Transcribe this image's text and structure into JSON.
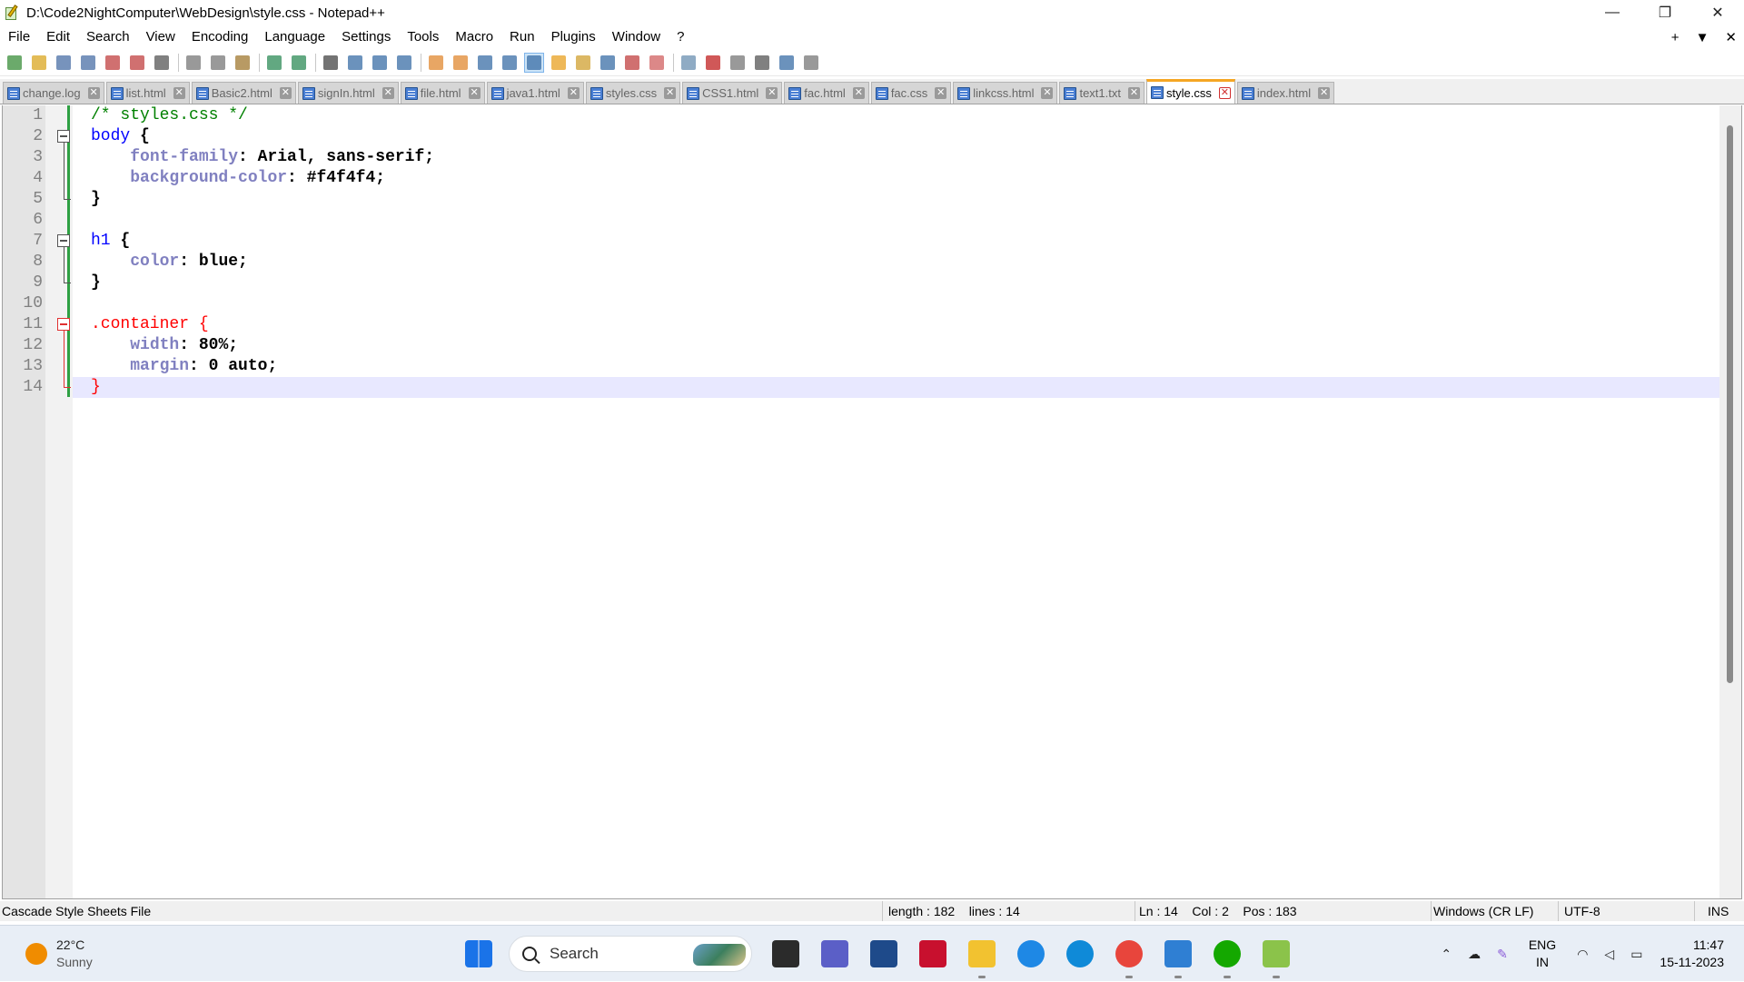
{
  "window": {
    "title": "D:\\Code2NightComputer\\WebDesign\\style.css - Notepad++",
    "controls": [
      "—",
      "❐",
      "✕"
    ]
  },
  "menu": {
    "items": [
      "File",
      "Edit",
      "Search",
      "View",
      "Encoding",
      "Language",
      "Settings",
      "Tools",
      "Macro",
      "Run",
      "Plugins",
      "Window",
      "?"
    ],
    "right": [
      "+",
      "▼",
      "✕"
    ]
  },
  "toolbar": {
    "icons": [
      "new-file-icon",
      "open-file-icon",
      "save-icon",
      "save-all-icon",
      "close-icon",
      "close-all-icon",
      "print-icon",
      "cut-icon",
      "copy-icon",
      "paste-icon",
      "undo-icon",
      "redo-icon",
      "find-icon",
      "replace-icon",
      "zoom-in-icon",
      "zoom-out-icon",
      "sync-vertical-icon",
      "sync-horizontal-icon",
      "word-wrap-icon",
      "show-all-chars-icon",
      "indent-guide-icon",
      "user-lang-icon",
      "doc-map-icon",
      "function-list-icon",
      "folder-workspace-icon",
      "monitoring-icon",
      "eye-icon",
      "record-macro-icon",
      "stop-macro-icon",
      "play-macro-icon",
      "run-macro-multiple-icon",
      "save-macro-icon"
    ]
  },
  "tabs": [
    {
      "label": "change.log",
      "active": false
    },
    {
      "label": "list.html",
      "active": false
    },
    {
      "label": "Basic2.html",
      "active": false
    },
    {
      "label": "signIn.html",
      "active": false
    },
    {
      "label": "file.html",
      "active": false
    },
    {
      "label": "java1.html",
      "active": false
    },
    {
      "label": "styles.css",
      "active": false
    },
    {
      "label": "CSS1.html",
      "active": false
    },
    {
      "label": "fac.html",
      "active": false
    },
    {
      "label": "fac.css",
      "active": false
    },
    {
      "label": "linkcss.html",
      "active": false
    },
    {
      "label": "text1.txt",
      "active": false
    },
    {
      "label": "style.css",
      "active": true
    },
    {
      "label": "index.html",
      "active": false
    }
  ],
  "editor": {
    "current_line": 14,
    "lines": [
      {
        "n": "1",
        "tokens": [
          {
            "t": "/* styles.css */",
            "c": "comment"
          }
        ]
      },
      {
        "n": "2",
        "tokens": [
          {
            "t": "body",
            "c": "tag"
          },
          {
            "t": " {",
            "c": "punc"
          }
        ]
      },
      {
        "n": "3",
        "tokens": [
          {
            "t": "    ",
            "c": "punc"
          },
          {
            "t": "font-family",
            "c": "prop"
          },
          {
            "t": ": Arial, sans-serif;",
            "c": "val"
          }
        ]
      },
      {
        "n": "4",
        "tokens": [
          {
            "t": "    ",
            "c": "punc"
          },
          {
            "t": "background-color",
            "c": "prop"
          },
          {
            "t": ": #f4f4f4;",
            "c": "val"
          }
        ]
      },
      {
        "n": "5",
        "tokens": [
          {
            "t": "}",
            "c": "punc"
          }
        ]
      },
      {
        "n": "6",
        "tokens": []
      },
      {
        "n": "7",
        "tokens": [
          {
            "t": "h1",
            "c": "tag"
          },
          {
            "t": " {",
            "c": "punc"
          }
        ]
      },
      {
        "n": "8",
        "tokens": [
          {
            "t": "    ",
            "c": "punc"
          },
          {
            "t": "color",
            "c": "prop"
          },
          {
            "t": ": blue;",
            "c": "val"
          }
        ]
      },
      {
        "n": "9",
        "tokens": [
          {
            "t": "}",
            "c": "punc"
          }
        ]
      },
      {
        "n": "10",
        "tokens": []
      },
      {
        "n": "11",
        "tokens": [
          {
            "t": ".container {",
            "c": "err"
          }
        ]
      },
      {
        "n": "12",
        "tokens": [
          {
            "t": "    ",
            "c": "punc"
          },
          {
            "t": "width",
            "c": "prop"
          },
          {
            "t": ": 80%;",
            "c": "val"
          }
        ]
      },
      {
        "n": "13",
        "tokens": [
          {
            "t": "    ",
            "c": "punc"
          },
          {
            "t": "margin",
            "c": "prop"
          },
          {
            "t": ": 0 auto;",
            "c": "val"
          }
        ]
      },
      {
        "n": "14",
        "tokens": [
          {
            "t": "}",
            "c": "err"
          }
        ]
      }
    ]
  },
  "status": {
    "file_type": "Cascade Style Sheets File",
    "length": "length : 182",
    "lines": "lines : 14",
    "ln": "Ln : 14",
    "col": "Col : 2",
    "pos": "Pos : 183",
    "eol": "Windows (CR LF)",
    "encoding": "UTF-8",
    "mode": "INS"
  },
  "taskbar": {
    "weather_temp": "22°C",
    "weather_cond": "Sunny",
    "search_label": "Search",
    "apps": [
      {
        "name": "start-icon",
        "color": "#1a73e8"
      },
      {
        "name": "task-view-icon",
        "color": "#2b2b2b"
      },
      {
        "name": "teams-chat-icon",
        "color": "#5b5fc7"
      },
      {
        "name": "microsoft-store-icon",
        "color": "#1e4a8a"
      },
      {
        "name": "mcafee-icon",
        "color": "#c8102e"
      },
      {
        "name": "file-explorer-icon",
        "color": "#f2c230"
      },
      {
        "name": "get-help-icon",
        "color": "#1e88e5"
      },
      {
        "name": "edge-icon",
        "color": "#0f8ad8"
      },
      {
        "name": "chrome-icon",
        "color": "#e8453c"
      },
      {
        "name": "notepad-icon",
        "color": "#2f7fd3"
      },
      {
        "name": "upwork-icon",
        "color": "#14a800"
      },
      {
        "name": "notepad-plus-plus-icon",
        "color": "#8bc34a"
      }
    ],
    "lang_top": "ENG",
    "lang_bottom": "IN",
    "time": "11:47",
    "date": "15-11-2023"
  }
}
